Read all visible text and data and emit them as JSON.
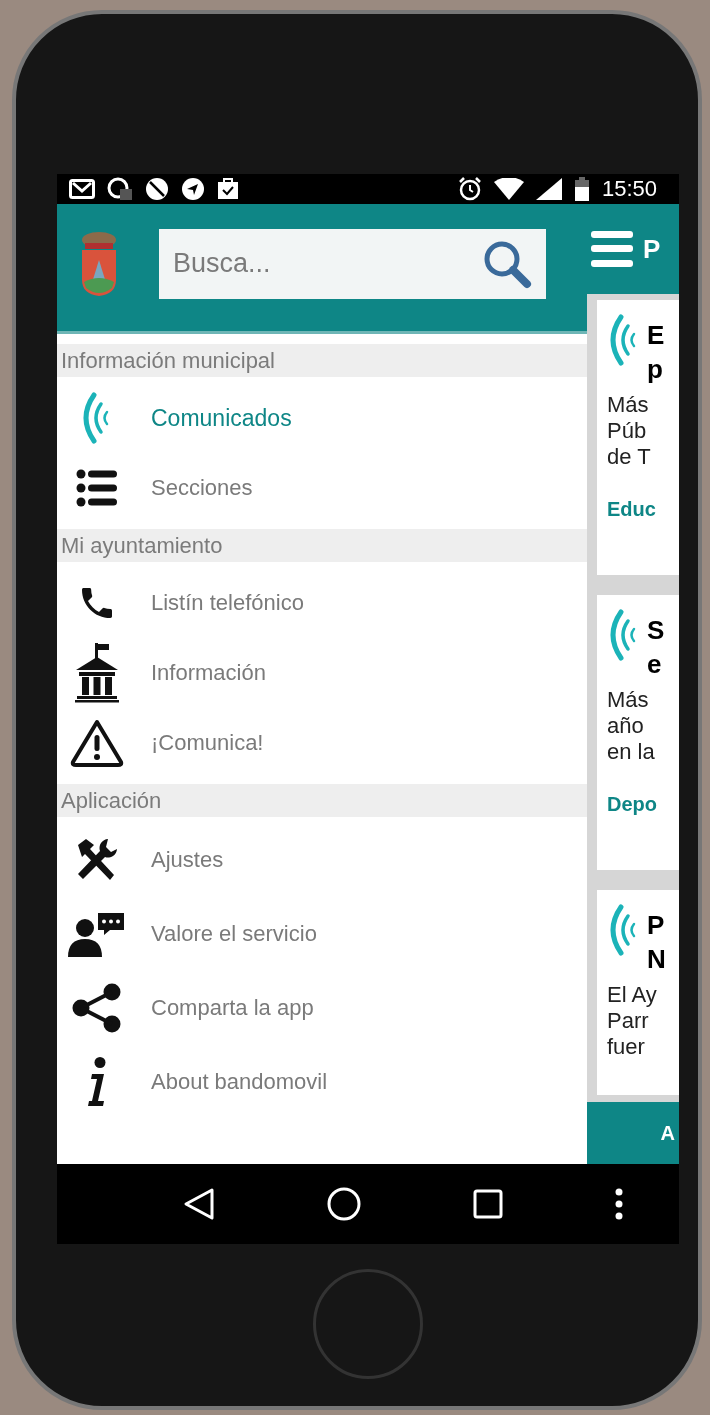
{
  "status_bar": {
    "time": "15:50"
  },
  "search": {
    "placeholder": "Busca..."
  },
  "header_title": "P",
  "menu": {
    "sections": [
      {
        "title": "Información municipal",
        "items": [
          {
            "label": "Comunicados",
            "selected": true
          },
          {
            "label": "Secciones",
            "selected": false
          }
        ]
      },
      {
        "title": "Mi ayuntamiento",
        "items": [
          {
            "label": "Listín telefónico",
            "selected": false
          },
          {
            "label": "Información",
            "selected": false
          },
          {
            "label": "¡Comunica!",
            "selected": false
          }
        ]
      },
      {
        "title": "Aplicación",
        "items": [
          {
            "label": "Ajustes",
            "selected": false
          },
          {
            "label": "Valore el servicio",
            "selected": false
          },
          {
            "label": "Comparta la app",
            "selected": false
          },
          {
            "label": "About bandomovil",
            "selected": false
          }
        ]
      }
    ]
  },
  "cards": [
    {
      "title_lines": [
        "E",
        "p"
      ],
      "body_lines": [
        "Más",
        "Púb",
        "de T"
      ],
      "category": "Educ"
    },
    {
      "title_lines": [
        "S",
        "e"
      ],
      "body_lines": [
        "Más",
        "año",
        "en la"
      ],
      "category": "Depo"
    },
    {
      "title_lines": [
        "P",
        "N"
      ],
      "body_lines": [
        "El Ay",
        "Parr",
        "fuer"
      ]
    }
  ],
  "bottom_bar": {
    "label": "A"
  }
}
